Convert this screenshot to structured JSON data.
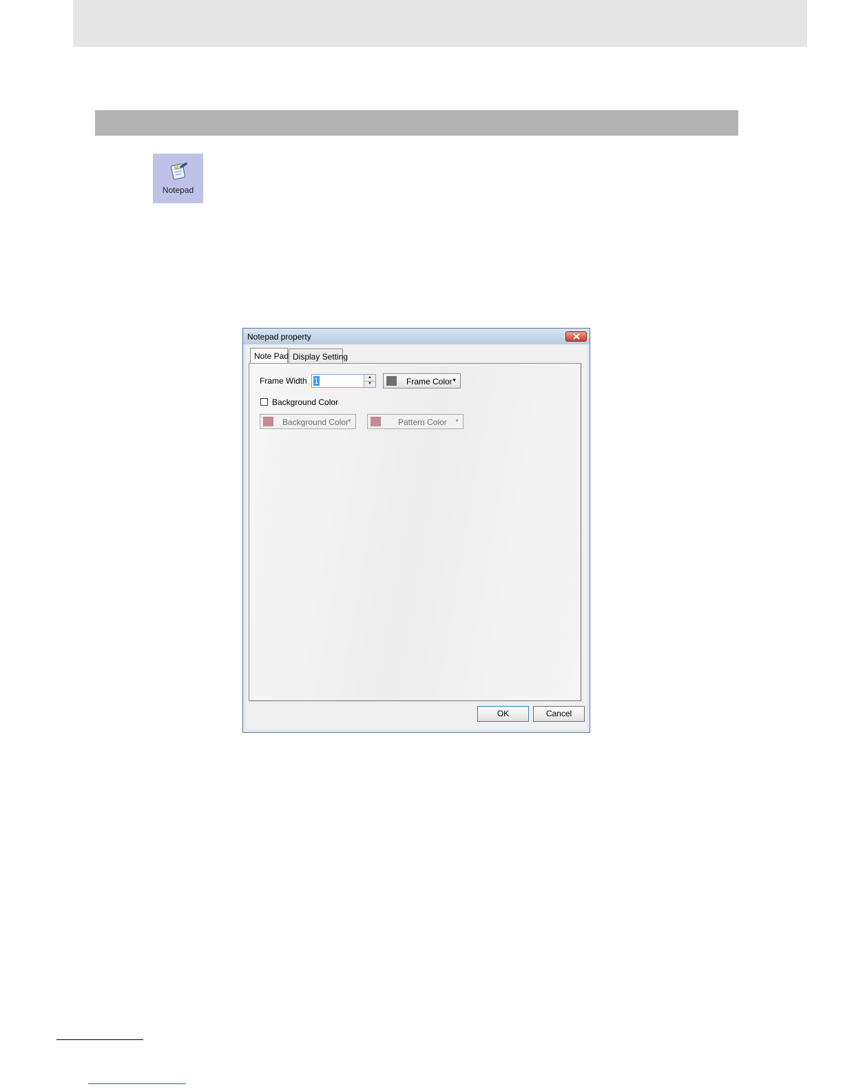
{
  "toolbox": {
    "notepad_label": "Notepad",
    "notepad_icon": "notepad-icon"
  },
  "dialog": {
    "title": "Notepad property",
    "tabs": [
      "Note Pad",
      "Display Setting"
    ],
    "active_tab": "Note Pad",
    "frame_width_label": "Frame Width",
    "frame_width_value": "1",
    "frame_color_label": "Frame Color",
    "frame_color": "#6e6e73",
    "background_color_checkbox_label": "Background Color",
    "background_color_checked": false,
    "background_color_button_label": "Background Color",
    "background_color": "#c48a96",
    "pattern_color_button_label": "Pattern Color",
    "pattern_color": "#c48a96",
    "ok_label": "OK",
    "cancel_label": "Cancel"
  }
}
